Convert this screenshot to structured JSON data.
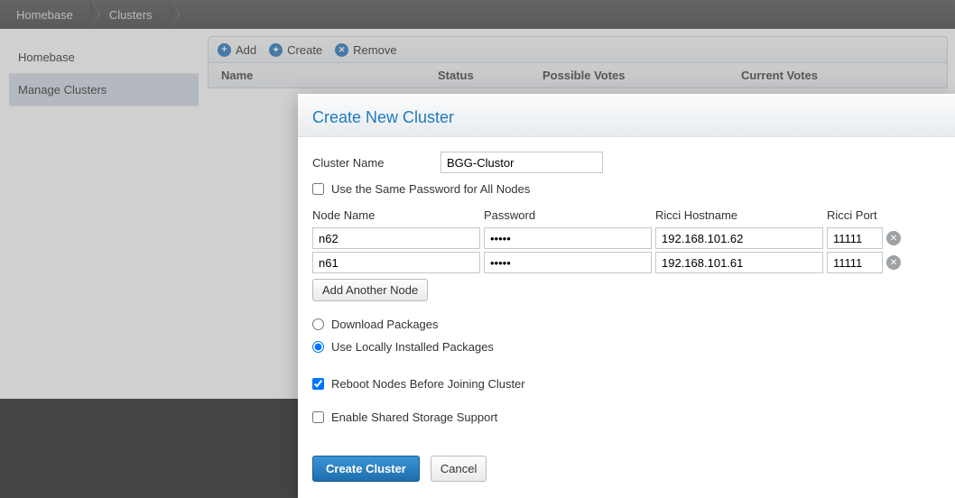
{
  "breadcrumb": {
    "items": [
      "Homebase",
      "Clusters"
    ]
  },
  "sidebar": {
    "items": [
      {
        "label": "Homebase",
        "active": false
      },
      {
        "label": "Manage Clusters",
        "active": true
      }
    ]
  },
  "toolbar": {
    "add": "Add",
    "create": "Create",
    "remove": "Remove"
  },
  "table": {
    "headers": {
      "name": "Name",
      "status": "Status",
      "possible_votes": "Possible Votes",
      "current_votes": "Current Votes"
    }
  },
  "dialog": {
    "title": "Create New Cluster",
    "cluster_name_label": "Cluster Name",
    "cluster_name": "BGG-Clustor",
    "same_password_label": "Use the Same Password for All Nodes",
    "same_password_checked": false,
    "node_headers": {
      "name": "Node Name",
      "password": "Password",
      "ricci_host": "Ricci Hostname",
      "ricci_port": "Ricci Port"
    },
    "nodes": [
      {
        "name": "n62",
        "password": "•••••",
        "ricci_host": "192.168.101.62",
        "ricci_port": "11111"
      },
      {
        "name": "n61",
        "password": "•••••",
        "ricci_host": "192.168.101.61",
        "ricci_port": "11111"
      }
    ],
    "add_another_node": "Add Another Node",
    "pkg_download": "Download Packages",
    "pkg_local": "Use Locally Installed Packages",
    "pkg_choice": "local",
    "reboot_label": "Reboot Nodes Before Joining Cluster",
    "reboot_checked": true,
    "shared_storage_label": "Enable Shared Storage Support",
    "shared_storage_checked": false,
    "create_btn": "Create Cluster",
    "cancel_btn": "Cancel"
  }
}
